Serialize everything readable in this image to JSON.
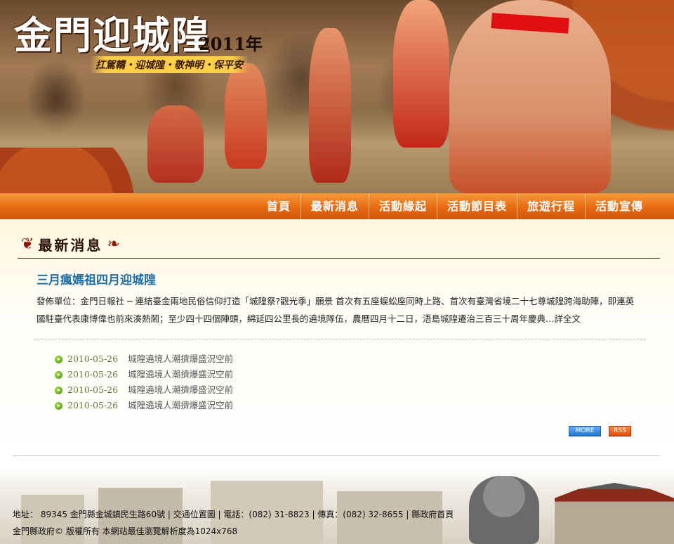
{
  "banner": {
    "logo": "金門迎城隍",
    "year": "2011年",
    "slogan": "扛駕轎・迎城隍・敬神明・保平安"
  },
  "nav": {
    "items": [
      "首頁",
      "最新消息",
      "活動緣起",
      "活動節目表",
      "旅遊行程",
      "活動宣傳"
    ]
  },
  "section": {
    "title": "最新消息"
  },
  "featured": {
    "headline": "三月瘋媽祖四月迎城隍",
    "summary": "發佈單位：金門日報社 ─ 連結臺金兩地民俗信仰打造「城隍祭?觀光季」願景 首次有五座蜈蚣座同時上路、首次有臺灣省境二十七尊城隍跨海助陣，即連英國駐臺代表康博偉也前來湊熱鬧；至少四十四個陣頭，綿延四公里長的遶境隊伍，農曆四月十二日，浯島城隍遷治三百三十周年慶典…詳全文"
  },
  "news": [
    {
      "date": "2010-05-26",
      "title": "城隍遶境人潮擠爆盛況空前"
    },
    {
      "date": "2010-05-26",
      "title": "城隍遶境人潮擠爆盛況空前"
    },
    {
      "date": "2010-05-26",
      "title": "城隍遶境人潮擠爆盛況空前"
    },
    {
      "date": "2010-05-26",
      "title": "城隍遶境人潮擠爆盛況空前"
    }
  ],
  "buttons": {
    "more": "MORE",
    "rss": "RSS"
  },
  "footer": {
    "address": "地址： 89345 金門縣金城鎮民生路60號 | 交通位置圖 | 電話：(082) 31-8823 | 傳真：(082) 32-8655 | 縣政府首頁",
    "copyright": "金門縣政府© 版權所有 本網站最佳瀏覽解析度為1024x768"
  }
}
